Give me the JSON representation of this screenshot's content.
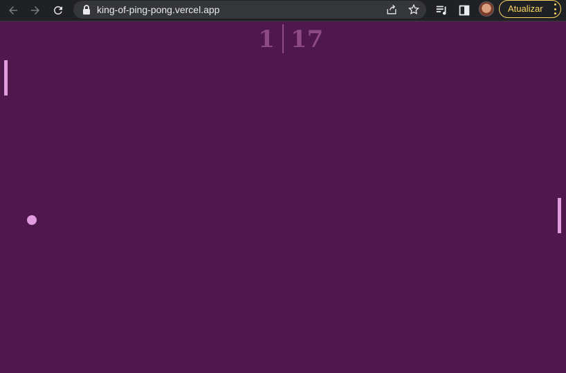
{
  "browser": {
    "url": "king-of-ping-pong.vercel.app",
    "update_label": "Atualizar",
    "icons": [
      "back-arrow-icon",
      "forward-arrow-icon",
      "reload-icon",
      "lock-icon",
      "share-icon",
      "star-icon",
      "media-control-icon",
      "side-panel-icon",
      "avatar",
      "more-icon"
    ]
  },
  "game": {
    "score_left": "1",
    "score_right": "17",
    "colors": {
      "background": "#4f184c",
      "score": "#8d4a86",
      "paddle": "#e39be0",
      "ball": "#e39be0"
    }
  }
}
